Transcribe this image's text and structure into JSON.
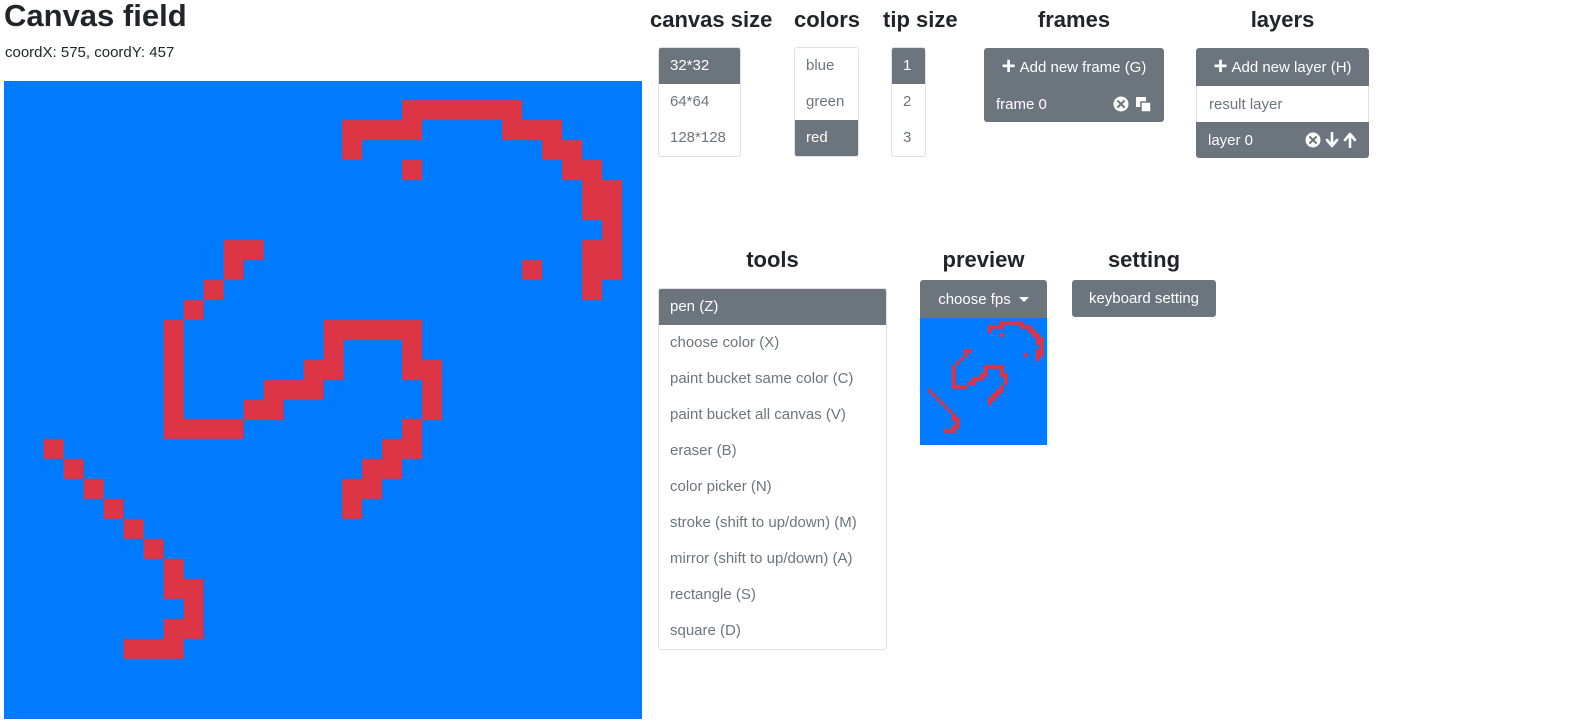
{
  "page": {
    "title": "Canvas field",
    "coords": "coordX: 575, coordY: 457"
  },
  "canvas_size": {
    "title": "canvas size",
    "items": [
      "32*32",
      "64*64",
      "128*128"
    ],
    "selected": "32*32"
  },
  "colors": {
    "title": "colors",
    "items": [
      "blue",
      "green",
      "red"
    ],
    "selected": "red"
  },
  "tip_size": {
    "title": "tip size",
    "items": [
      "1",
      "2",
      "3"
    ],
    "selected": "1"
  },
  "frames": {
    "title": "frames",
    "add_label": "Add new frame (G)",
    "items": [
      "frame 0"
    ]
  },
  "layers": {
    "title": "layers",
    "add_label": "Add new layer (H)",
    "result_label": "result layer",
    "items": [
      "layer 0"
    ]
  },
  "tools": {
    "title": "tools",
    "items": [
      "pen (Z)",
      "choose color (X)",
      "paint bucket same color (C)",
      "paint bucket all canvas (V)",
      "eraser (B)",
      "color picker (N)",
      "stroke (shift to up/down) (M)",
      "mirror (shift to up/down) (A)",
      "rectangle (S)",
      "square (D)"
    ],
    "selected": "pen (Z)"
  },
  "preview": {
    "title": "preview",
    "fps_label": "choose fps"
  },
  "setting": {
    "title": "setting",
    "keyboard_label": "keyboard setting"
  },
  "theme": {
    "canvas_bg": "#007bff",
    "pixel_color": "#dc3545",
    "active_bg": "#6c757d"
  },
  "drawing": {
    "grid": 32,
    "pixels": [
      [
        20,
        1
      ],
      [
        21,
        1
      ],
      [
        20,
        2
      ],
      [
        17,
        2
      ],
      [
        18,
        2
      ],
      [
        19,
        2
      ],
      [
        17,
        3
      ],
      [
        20,
        4
      ],
      [
        22,
        1
      ],
      [
        23,
        1
      ],
      [
        24,
        1
      ],
      [
        25,
        1
      ],
      [
        25,
        2
      ],
      [
        26,
        2
      ],
      [
        27,
        2
      ],
      [
        27,
        3
      ],
      [
        28,
        3
      ],
      [
        28,
        4
      ],
      [
        29,
        4
      ],
      [
        29,
        5
      ],
      [
        30,
        5
      ],
      [
        29,
        6
      ],
      [
        30,
        6
      ],
      [
        30,
        7
      ],
      [
        29,
        8
      ],
      [
        30,
        8
      ],
      [
        29,
        9
      ],
      [
        30,
        9
      ],
      [
        29,
        10
      ],
      [
        26,
        9
      ],
      [
        11,
        8
      ],
      [
        12,
        8
      ],
      [
        11,
        9
      ],
      [
        10,
        10
      ],
      [
        9,
        11
      ],
      [
        8,
        12
      ],
      [
        8,
        13
      ],
      [
        8,
        14
      ],
      [
        8,
        15
      ],
      [
        8,
        16
      ],
      [
        8,
        17
      ],
      [
        9,
        17
      ],
      [
        10,
        17
      ],
      [
        11,
        17
      ],
      [
        12,
        16
      ],
      [
        13,
        16
      ],
      [
        13,
        15
      ],
      [
        14,
        15
      ],
      [
        15,
        15
      ],
      [
        15,
        14
      ],
      [
        16,
        14
      ],
      [
        16,
        13
      ],
      [
        16,
        12
      ],
      [
        17,
        12
      ],
      [
        18,
        12
      ],
      [
        19,
        12
      ],
      [
        20,
        12
      ],
      [
        20,
        13
      ],
      [
        20,
        14
      ],
      [
        21,
        14
      ],
      [
        21,
        15
      ],
      [
        21,
        16
      ],
      [
        20,
        17
      ],
      [
        20,
        18
      ],
      [
        19,
        18
      ],
      [
        19,
        19
      ],
      [
        18,
        19
      ],
      [
        18,
        20
      ],
      [
        17,
        20
      ],
      [
        17,
        21
      ],
      [
        2,
        18
      ],
      [
        3,
        19
      ],
      [
        4,
        20
      ],
      [
        5,
        21
      ],
      [
        6,
        22
      ],
      [
        7,
        23
      ],
      [
        8,
        24
      ],
      [
        8,
        25
      ],
      [
        9,
        25
      ],
      [
        9,
        26
      ],
      [
        9,
        27
      ],
      [
        8,
        27
      ],
      [
        7,
        28
      ],
      [
        8,
        28
      ],
      [
        6,
        28
      ]
    ]
  }
}
